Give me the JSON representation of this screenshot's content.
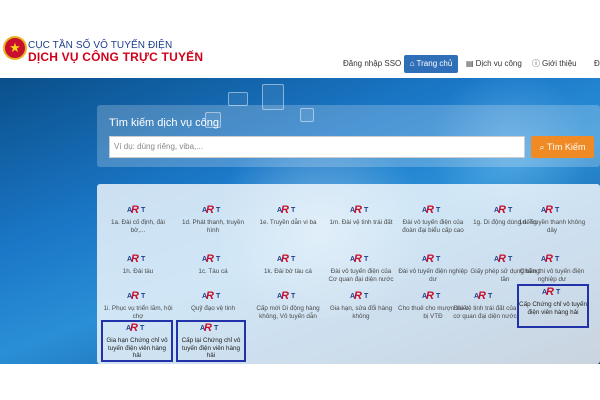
{
  "header": {
    "org_name": "CỤC TẦN SỐ VÔ TUYẾN ĐIỆN",
    "service_name": "DỊCH VỤ CÔNG TRỰC TUYẾN",
    "nav": {
      "login": "Đăng nhập SSO",
      "home": "Trang chủ",
      "catalog": "Dịch vụ công",
      "about": "Giới thiệu",
      "more": "Đ"
    }
  },
  "search": {
    "title": "Tìm kiếm dịch vụ công",
    "placeholder": "Ví dụ: dùng riêng, viba,...",
    "button_label": "Tìm Kiếm"
  },
  "services": [
    {
      "label": "1a. Đài cố định, đài bờ,..."
    },
    {
      "label": "1d. Phát thanh, truyền hình"
    },
    {
      "label": "1e. Truyền dẫn vi ba"
    },
    {
      "label": "1m. Đài vệ tinh trái đất"
    },
    {
      "label": "Đài vô tuyến điện của đoàn đại biểu cấp cao"
    },
    {
      "label": "1g. Di động dùng riêng"
    },
    {
      "label": "1d. Truyền thanh không dây"
    },
    {
      "label": "1h. Đài tàu"
    },
    {
      "label": "1c. Tàu cá"
    },
    {
      "label": "1k. Đài bờ tàu cá"
    },
    {
      "label": "Đài vô tuyến điện của Cơ quan đại diện nước"
    },
    {
      "label": "Đài vô tuyến điện nghiệp dư"
    },
    {
      "label": "Giấy phép sử dụng băng tần"
    },
    {
      "label": "Chấm thi vô tuyến điện nghiệp dư"
    },
    {
      "label": "1i. Phục vụ triển lãm, hội chợ"
    },
    {
      "label": "Quỹ đạo vệ tinh"
    },
    {
      "label": "Cấp mới Di động hàng không, Vô tuyến dẫn"
    },
    {
      "label": "Gia hạn, sửa đổi hàng không"
    },
    {
      "label": "Cho thuê cho mượn thiết bị VTĐ"
    },
    {
      "label": "Đài vệ tinh trái đất của cơ quan đại diện nước"
    },
    {
      "label": "Cấp Chứng chỉ vô tuyến điện viên hàng hải"
    },
    {
      "label": "Gia hạn Chứng chỉ vô tuyến điện viên hàng hải"
    },
    {
      "label": "Cấp lại Chứng chỉ vô tuyến điện viên hàng hải"
    }
  ],
  "logo_text": {
    "a": "A",
    "r": "R",
    "t": "T"
  },
  "colors": {
    "brand_red": "#d0021b",
    "brand_blue": "#1c3f8c",
    "nav_active": "#2f6fb8",
    "search_button": "#f08a24",
    "highlight_border": "#2233aa"
  },
  "icons": {
    "home": "home-icon",
    "catalog": "list-icon",
    "about": "info-icon",
    "search": "search-icon"
  }
}
